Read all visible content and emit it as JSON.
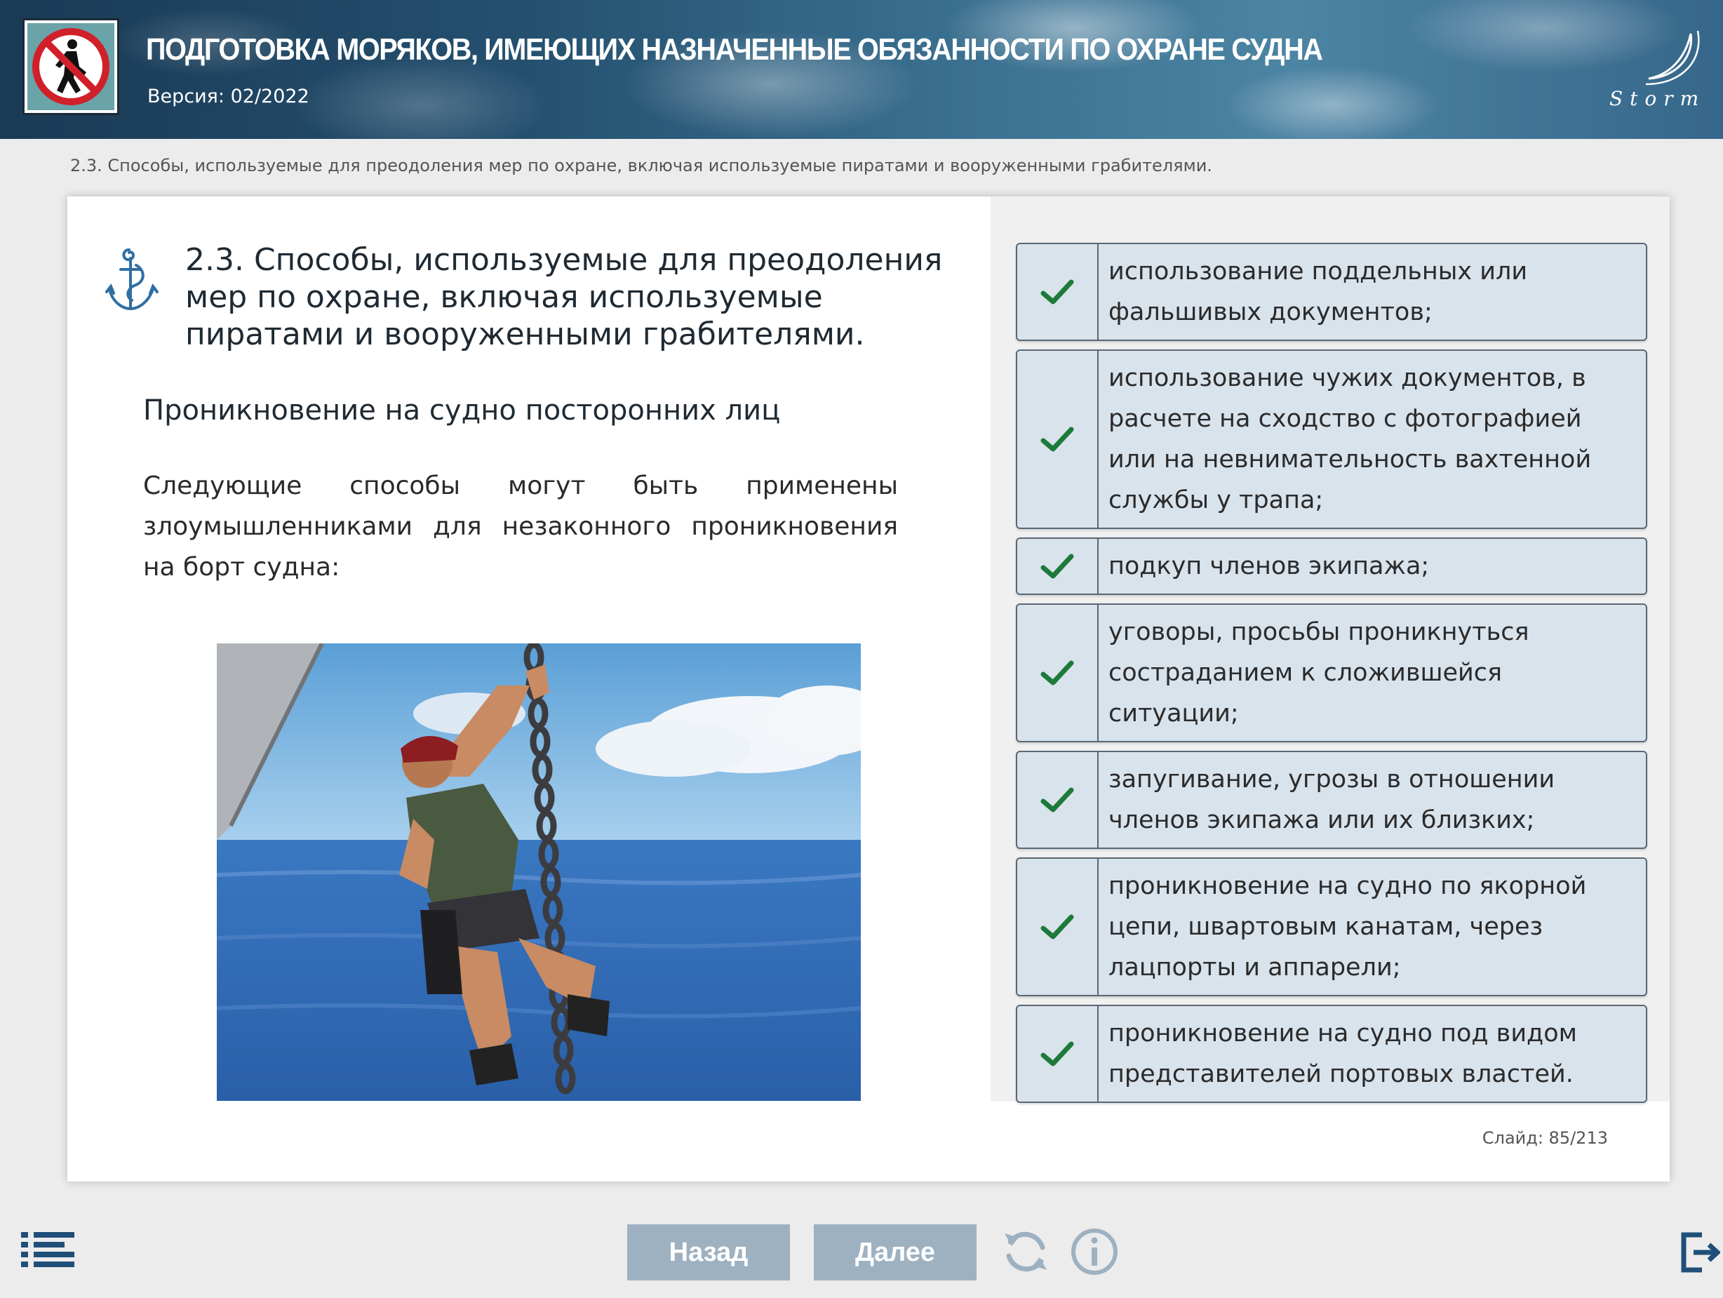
{
  "header": {
    "title": "ПОДГОТОВКА МОРЯКОВ, ИМЕЮЩИХ НАЗНАЧЕННЫЕ ОБЯЗАННОСТИ ПО ОХРАНЕ СУДНА",
    "version": "Версия: 02/2022",
    "logo_icon": "no-pedestrian-icon",
    "brand_icon": "storm-logo-icon"
  },
  "breadcrumb": "2.3. Способы, используемые для преодоления мер по охране, включая используемые пиратами и вооруженными грабителями.",
  "slide": {
    "title": "2.3. Способы, используемые для преодоления мер по охране, включая используемые пиратами и вооруженными грабителями.",
    "section_heading": "Проникновение на судно посторонних лиц",
    "paragraph": "Следующие способы могут быть применены злоумышленниками для незаконного проникновения на борт судна:",
    "illustration": "pirate-climbing-anchor-chain"
  },
  "items": [
    {
      "text": "использование поддельных или фальшивых документов;"
    },
    {
      "text": "использование чужих документов, в расчете на сходство с фотографией или на невнимательность вахтенной службы у трапа;"
    },
    {
      "text": "подкуп членов экипажа;"
    },
    {
      "text": "уговоры, просьбы проникнуться состраданием к сложившейся ситуации;"
    },
    {
      "text": "запугивание, угрозы в отношении членов экипажа или их близких;"
    },
    {
      "text": "проникновение на судно по якорной цепи, швартовым канатам, через лацпорты и аппарели;"
    },
    {
      "text": "проникновение на судно под видом представителей портовых властей."
    }
  ],
  "slide_counter": "Слайд:  85/213",
  "footer": {
    "back_label": "Назад",
    "next_label": "Далее"
  },
  "colors": {
    "check": "#1d7a3a",
    "item_bg": "#d9e3ec",
    "button_bg": "#9eb1c1",
    "icon": "#1f4f78"
  }
}
